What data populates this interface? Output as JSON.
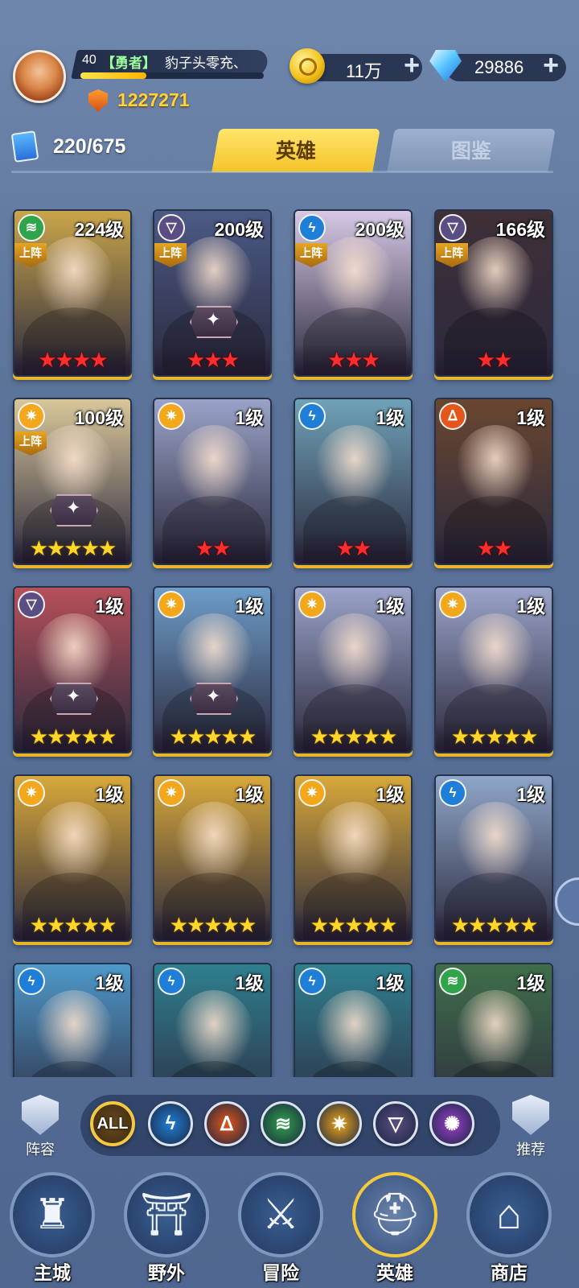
{
  "header": {
    "player_level": "40",
    "title_badge": "【勇者】",
    "player_name": "豹子头零充、",
    "exp_progress": 0.36,
    "combat_power": "1227271",
    "gold": "11万",
    "diamonds": "29886",
    "hero_count": "220/675"
  },
  "tabs": {
    "heroes": "英雄",
    "album": "图鉴"
  },
  "deployed_label": "上阵",
  "colors": {
    "accent_gold": "#f5c32a",
    "star_red": "#ff2d2d",
    "star_gold": "#ffd629",
    "element_nature": "#2fa44a",
    "element_water": "#1f7fd8",
    "element_fire": "#e4561a",
    "element_light": "#f2a81a",
    "element_dark": "#5a4d84",
    "element_arcane": "#9a3fd0"
  },
  "heroes": [
    {
      "level": "224级",
      "element": "nature",
      "stars": 4,
      "star_color": "red",
      "deployed": true,
      "art": "#c9a54a"
    },
    {
      "level": "200级",
      "element": "dark",
      "stars": 3,
      "star_color": "red",
      "deployed": true,
      "art": "#4b5a86",
      "crest": true
    },
    {
      "level": "200级",
      "element": "water",
      "stars": 3,
      "star_color": "red",
      "deployed": true,
      "art": "#d7c9e6"
    },
    {
      "level": "166级",
      "element": "dark",
      "stars": 2,
      "star_color": "red",
      "deployed": true,
      "art": "#3f2f36"
    },
    {
      "level": "100级",
      "element": "light",
      "stars": 5,
      "star_color": "gold",
      "deployed": true,
      "art": "#d9c79a",
      "crest": true
    },
    {
      "level": "1级",
      "element": "light",
      "stars": 2,
      "star_color": "red",
      "deployed": false,
      "art": "#9aa3c8"
    },
    {
      "level": "1级",
      "element": "water",
      "stars": 2,
      "star_color": "red",
      "deployed": false,
      "art": "#6fa2b8"
    },
    {
      "level": "1级",
      "element": "fire",
      "stars": 2,
      "star_color": "red",
      "deployed": false,
      "art": "#6a4630"
    },
    {
      "level": "1级",
      "element": "dark",
      "stars": 5,
      "star_color": "gold",
      "deployed": false,
      "art": "#b5505a",
      "crest": true
    },
    {
      "level": "1级",
      "element": "light",
      "stars": 5,
      "star_color": "gold",
      "deployed": false,
      "art": "#6d9cc8",
      "crest": true
    },
    {
      "level": "1级",
      "element": "light",
      "stars": 5,
      "star_color": "gold",
      "deployed": false,
      "art": "#9aa3c8"
    },
    {
      "level": "1级",
      "element": "light",
      "stars": 5,
      "star_color": "gold",
      "deployed": false,
      "art": "#9aa3c8"
    },
    {
      "level": "1级",
      "element": "light",
      "stars": 5,
      "star_color": "gold",
      "deployed": false,
      "art": "#d8a83a"
    },
    {
      "level": "1级",
      "element": "light",
      "stars": 5,
      "star_color": "gold",
      "deployed": false,
      "art": "#d8a83a"
    },
    {
      "level": "1级",
      "element": "light",
      "stars": 5,
      "star_color": "gold",
      "deployed": false,
      "art": "#d8a83a"
    },
    {
      "level": "1级",
      "element": "water",
      "stars": 5,
      "star_color": "gold",
      "deployed": false,
      "art": "#8fa6c9"
    },
    {
      "level": "1级",
      "element": "water",
      "stars": 0,
      "star_color": "gold",
      "deployed": false,
      "art": "#4e98c9"
    },
    {
      "level": "1级",
      "element": "water",
      "stars": 0,
      "star_color": "gold",
      "deployed": false,
      "art": "#2f7f8f"
    },
    {
      "level": "1级",
      "element": "water",
      "stars": 0,
      "star_color": "gold",
      "deployed": false,
      "art": "#2f7f8f"
    },
    {
      "level": "1级",
      "element": "nature",
      "stars": 0,
      "star_color": "gold",
      "deployed": false,
      "art": "#3f6e4a"
    }
  ],
  "filter_bar": {
    "lineup_label": "阵容",
    "recommend_label": "推荐",
    "all_label": "ALL",
    "filters": [
      {
        "name": "water",
        "glyph": "ϟ"
      },
      {
        "name": "fire",
        "glyph": "ᐃ"
      },
      {
        "name": "nature",
        "glyph": "≋"
      },
      {
        "name": "light",
        "glyph": "✷"
      },
      {
        "name": "dark",
        "glyph": "▽"
      },
      {
        "name": "arcane",
        "glyph": "✺"
      }
    ]
  },
  "bottom_nav": [
    {
      "label": "主城",
      "icon": "castle-icon",
      "glyph": "♜",
      "active": false
    },
    {
      "label": "野外",
      "icon": "wild-gate-icon",
      "glyph": "⛩",
      "active": false
    },
    {
      "label": "冒险",
      "icon": "sword-icon",
      "glyph": "⚔",
      "active": false
    },
    {
      "label": "英雄",
      "icon": "helmet-icon",
      "glyph": "⛑",
      "active": true
    },
    {
      "label": "商店",
      "icon": "shop-icon",
      "glyph": "⌂",
      "active": false
    }
  ]
}
